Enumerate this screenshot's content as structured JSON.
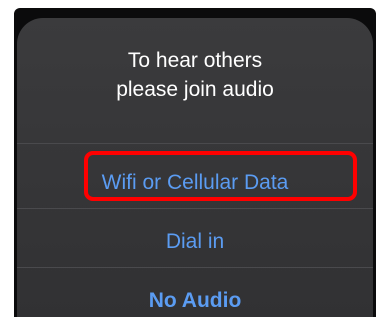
{
  "dialog": {
    "title_line1": "To hear others",
    "title_line2": "please join audio",
    "options": [
      {
        "label": "Wifi or Cellular Data",
        "highlighted": true
      },
      {
        "label": "Dial in"
      },
      {
        "label": "No Audio"
      }
    ]
  },
  "colors": {
    "option_text": "#5b9cf2",
    "highlight_border": "#ff0000",
    "sheet_background": "#363638"
  }
}
